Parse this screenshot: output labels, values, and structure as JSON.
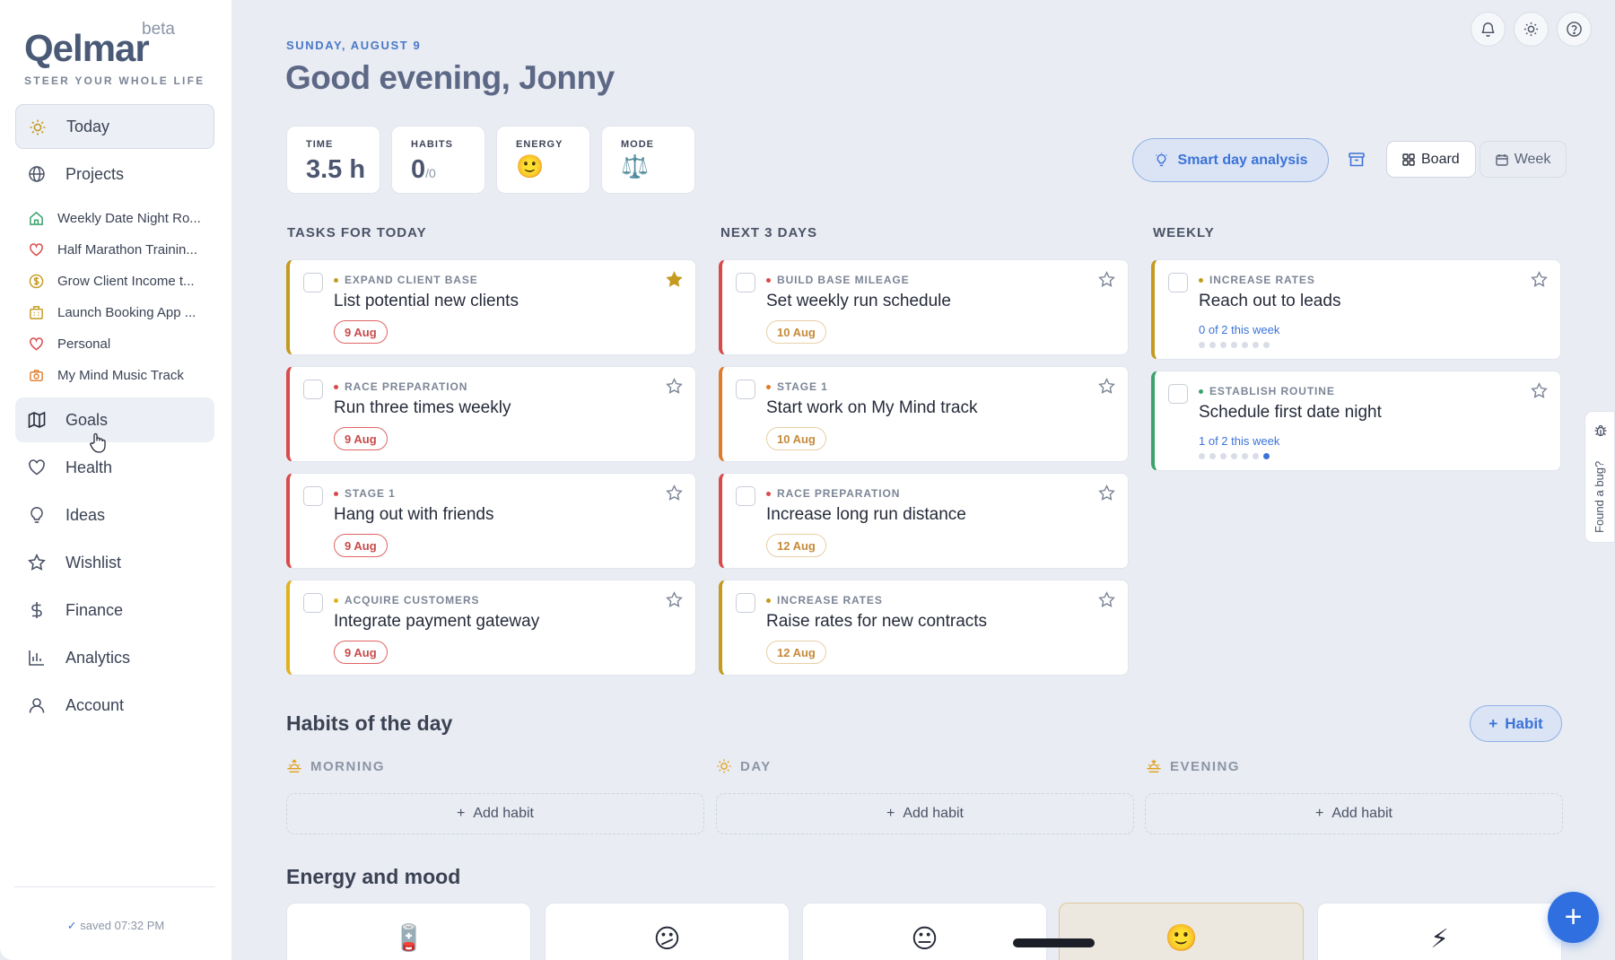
{
  "brand": {
    "name": "Qelmar",
    "badge": "beta",
    "tagline": "STEER YOUR WHOLE LIFE"
  },
  "nav_main": [
    {
      "label": "Today",
      "icon": "sun-icon",
      "active": true
    },
    {
      "label": "Projects",
      "icon": "globe-icon"
    }
  ],
  "projects": [
    {
      "label": "Weekly Date Night Ro...",
      "icon": "home-icon",
      "color": "#3aa36b"
    },
    {
      "label": "Half Marathon Trainin...",
      "icon": "heart-icon",
      "color": "#d94a4a"
    },
    {
      "label": "Grow Client Income t...",
      "icon": "dollar-icon",
      "color": "#c49a1f"
    },
    {
      "label": "Launch Booking App ...",
      "icon": "building-icon",
      "color": "#c49a1f"
    },
    {
      "label": "Personal",
      "icon": "heart-icon",
      "color": "#d94a4a"
    },
    {
      "label": "My Mind Music Track",
      "icon": "camera-icon",
      "color": "#e07b2a"
    }
  ],
  "nav_lower": [
    {
      "label": "Goals",
      "icon": "map-icon"
    },
    {
      "label": "Health",
      "icon": "heart-outline-icon"
    },
    {
      "label": "Ideas",
      "icon": "bulb-icon"
    },
    {
      "label": "Wishlist",
      "icon": "star-outline-icon"
    },
    {
      "label": "Finance",
      "icon": "dollar-sign-icon"
    },
    {
      "label": "Analytics",
      "icon": "bar-chart-icon"
    },
    {
      "label": "Account",
      "icon": "user-icon"
    }
  ],
  "saved": {
    "check": "✓",
    "text": "saved 07:32 PM"
  },
  "header": {
    "date": "SUNDAY, AUGUST 9",
    "greeting": "Good evening, Jonny"
  },
  "stats": {
    "time": {
      "label": "TIME",
      "value": "3.5 h"
    },
    "habits": {
      "label": "HABITS",
      "value": "0",
      "total": "/0"
    },
    "energy": {
      "label": "ENERGY",
      "value": "🙂"
    },
    "mode": {
      "label": "MODE",
      "value": "⚖️"
    }
  },
  "toolbar": {
    "smart": "Smart day analysis",
    "board": "Board",
    "week": "Week"
  },
  "columns": {
    "today": "TASKS FOR TODAY",
    "next": "NEXT 3 DAYS",
    "weekly": "WEEKLY"
  },
  "tasks_today": [
    {
      "tag": "EXPAND CLIENT BASE",
      "title": "List potential new clients",
      "due": "9 Aug",
      "starred": true,
      "color": "#c49a1f"
    },
    {
      "tag": "RACE PREPARATION",
      "title": "Run three times weekly",
      "due": "9 Aug",
      "starred": false,
      "color": "#d94a4a"
    },
    {
      "tag": "STAGE 1",
      "title": "Hang out with friends",
      "due": "9 Aug",
      "starred": false,
      "color": "#d94a4a"
    },
    {
      "tag": "ACQUIRE CUSTOMERS",
      "title": "Integrate payment gateway",
      "due": "9 Aug",
      "starred": false,
      "color": "#e0b21f"
    }
  ],
  "tasks_next": [
    {
      "tag": "BUILD BASE MILEAGE",
      "title": "Set weekly run schedule",
      "due": "10 Aug",
      "starred": false,
      "color": "#d94a4a"
    },
    {
      "tag": "STAGE 1",
      "title": "Start work on My Mind track",
      "due": "10 Aug",
      "starred": false,
      "color": "#e07b2a"
    },
    {
      "tag": "RACE PREPARATION",
      "title": "Increase long run distance",
      "due": "12 Aug",
      "starred": false,
      "color": "#d94a4a"
    },
    {
      "tag": "INCREASE RATES",
      "title": "Raise rates for new contracts",
      "due": "12 Aug",
      "starred": false,
      "color": "#c49a1f"
    }
  ],
  "tasks_weekly": [
    {
      "tag": "INCREASE RATES",
      "title": "Reach out to leads",
      "progress": "0 of 2 this week",
      "done_dots": 0,
      "color": "#c49a1f"
    },
    {
      "tag": "ESTABLISH ROUTINE",
      "title": "Schedule first date night",
      "progress": "1 of 2 this week",
      "done_dots": 1,
      "color": "#3aa36b"
    }
  ],
  "habits": {
    "title": "Habits of the day",
    "add_button": "Habit",
    "morning": "MORNING",
    "day": "DAY",
    "evening": "EVENING",
    "add_label": "Add habit"
  },
  "energy_section": {
    "title": "Energy and mood",
    "options": [
      "🪫",
      "😕",
      "😐",
      "🙂",
      "⚡"
    ],
    "selected": 3
  },
  "bug_tab": "Found a bug?",
  "fab": "+"
}
